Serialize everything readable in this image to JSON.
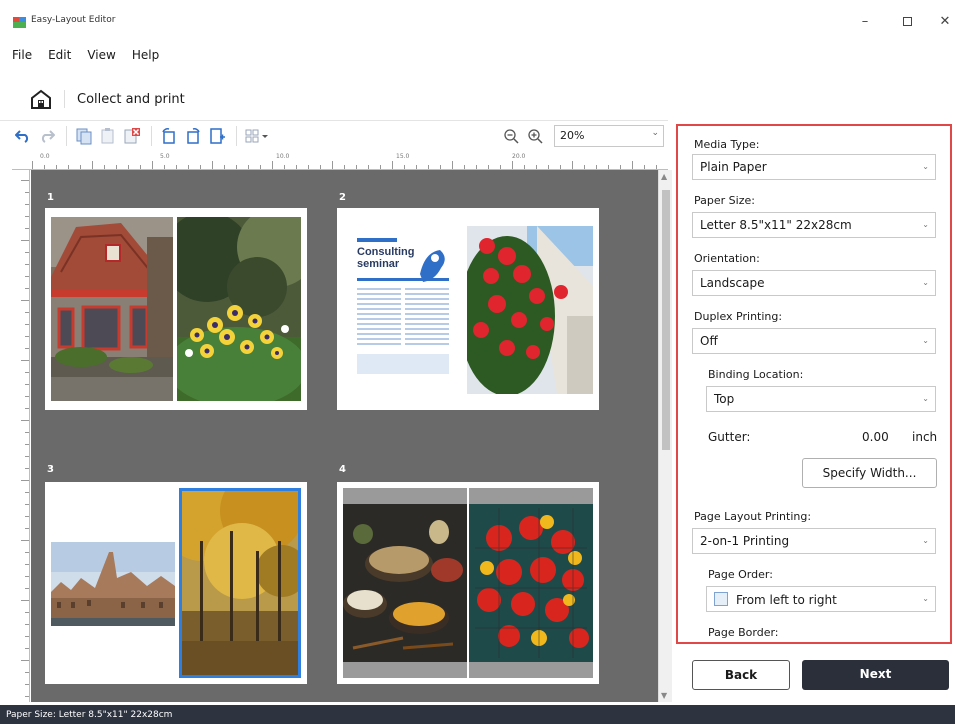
{
  "window": {
    "title": "Easy-Layout Editor",
    "minimize_glyph": "–",
    "close_glyph": "✕"
  },
  "menu": [
    "File",
    "Edit",
    "View",
    "Help"
  ],
  "breadcrumb": {
    "current": "Collect and print"
  },
  "toolbar": {
    "zoom_value": "20%"
  },
  "ruler": {
    "h_labels": [
      "0.0",
      "5.0",
      "10.0",
      "15.0",
      "20.0"
    ]
  },
  "pages": [
    {
      "number": "1"
    },
    {
      "number": "2"
    },
    {
      "number": "3"
    },
    {
      "number": "4"
    }
  ],
  "flyer": {
    "headline_1": "Consulting",
    "headline_2": "seminar"
  },
  "settings": {
    "media_type": {
      "label": "Media Type:",
      "value": "Plain Paper"
    },
    "paper_size": {
      "label": "Paper Size:",
      "value": "Letter 8.5\"x11\" 22x28cm"
    },
    "orientation": {
      "label": "Orientation:",
      "value": "Landscape"
    },
    "duplex": {
      "label": "Duplex Printing:",
      "value": "Off"
    },
    "binding_location": {
      "label": "Binding Location:",
      "value": "Top"
    },
    "gutter": {
      "label": "Gutter:",
      "value": "0.00",
      "unit": "inch"
    },
    "specify_width_label": "Specify Width...",
    "page_layout": {
      "label": "Page Layout Printing:",
      "value": "2-on-1 Printing"
    },
    "page_order": {
      "label": "Page Order:",
      "value": "From left to right"
    },
    "page_border": {
      "label": "Page Border:"
    }
  },
  "buttons": {
    "back": "Back",
    "next": "Next"
  },
  "status": {
    "text": "Paper Size: Letter 8.5\"x11\" 22x28cm"
  },
  "colors": {
    "highlight_border": "#e04848",
    "next_button_bg": "#2b2f3a",
    "statusbar_bg": "#2e3340",
    "canvas_bg": "#6a6a6a",
    "selection_blue": "#2f7fe0"
  }
}
